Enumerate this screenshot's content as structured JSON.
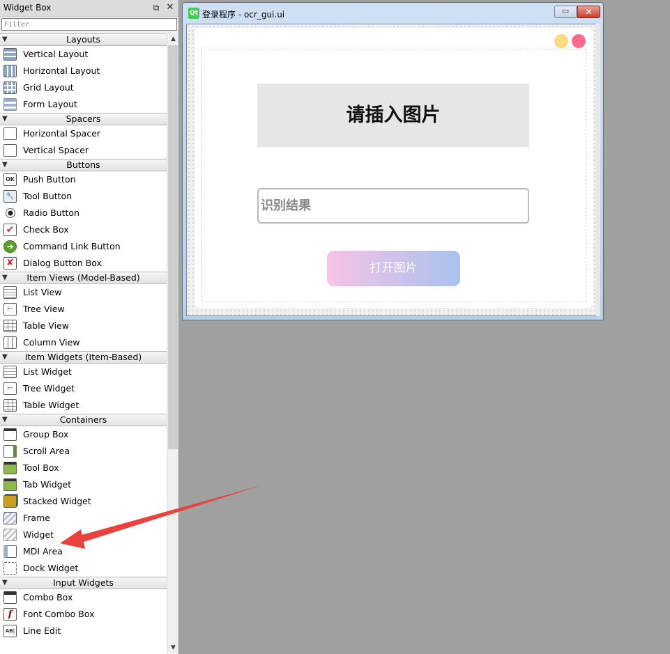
{
  "widget_box": {
    "title": "Widget Box",
    "float_icon": "⧉",
    "close_icon": "✕",
    "filter_placeholder": "Filter",
    "categories": [
      {
        "name": "Layouts",
        "items": [
          {
            "label": "Vertical Layout",
            "icon": "vertical-layout-icon"
          },
          {
            "label": "Horizontal Layout",
            "icon": "horizontal-layout-icon"
          },
          {
            "label": "Grid Layout",
            "icon": "grid-layout-icon"
          },
          {
            "label": "Form Layout",
            "icon": "form-layout-icon"
          }
        ]
      },
      {
        "name": "Spacers",
        "items": [
          {
            "label": "Horizontal Spacer",
            "icon": "horizontal-spacer-icon"
          },
          {
            "label": "Vertical Spacer",
            "icon": "vertical-spacer-icon"
          }
        ]
      },
      {
        "name": "Buttons",
        "items": [
          {
            "label": "Push Button",
            "icon": "push-button-icon",
            "glyph": "OK"
          },
          {
            "label": "Tool Button",
            "icon": "tool-button-icon",
            "glyph": "🔧"
          },
          {
            "label": "Radio Button",
            "icon": "radio-button-icon"
          },
          {
            "label": "Check Box",
            "icon": "check-box-icon",
            "glyph": "✔"
          },
          {
            "label": "Command Link Button",
            "icon": "command-link-icon",
            "glyph": "➜"
          },
          {
            "label": "Dialog Button Box",
            "icon": "dialog-button-box-icon",
            "glyph": "✘"
          }
        ]
      },
      {
        "name": "Item Views (Model-Based)",
        "items": [
          {
            "label": "List View",
            "icon": "list-view-icon"
          },
          {
            "label": "Tree View",
            "icon": "tree-view-icon",
            "glyph": "⊢"
          },
          {
            "label": "Table View",
            "icon": "table-view-icon"
          },
          {
            "label": "Column View",
            "icon": "column-view-icon"
          }
        ]
      },
      {
        "name": "Item Widgets (Item-Based)",
        "items": [
          {
            "label": "List Widget",
            "icon": "list-widget-icon"
          },
          {
            "label": "Tree Widget",
            "icon": "tree-widget-icon",
            "glyph": "⊢"
          },
          {
            "label": "Table Widget",
            "icon": "table-widget-icon"
          }
        ]
      },
      {
        "name": "Containers",
        "items": [
          {
            "label": "Group Box",
            "icon": "group-box-icon"
          },
          {
            "label": "Scroll Area",
            "icon": "scroll-area-icon"
          },
          {
            "label": "Tool Box",
            "icon": "tool-box-icon"
          },
          {
            "label": "Tab Widget",
            "icon": "tab-widget-icon"
          },
          {
            "label": "Stacked Widget",
            "icon": "stacked-widget-icon"
          },
          {
            "label": "Frame",
            "icon": "frame-icon"
          },
          {
            "label": "Widget",
            "icon": "widget-icon"
          },
          {
            "label": "MDI Area",
            "icon": "mdi-area-icon"
          },
          {
            "label": "Dock Widget",
            "icon": "dock-widget-icon"
          }
        ]
      },
      {
        "name": "Input Widgets",
        "items": [
          {
            "label": "Combo Box",
            "icon": "combo-box-icon"
          },
          {
            "label": "Font Combo Box",
            "icon": "font-combo-box-icon",
            "glyph": "f"
          },
          {
            "label": "Line Edit",
            "icon": "line-edit-icon",
            "glyph": "AB|"
          }
        ]
      }
    ]
  },
  "form_window": {
    "app_icon": "Qt",
    "title": "登录程序 - ocr_gui.ui",
    "minimize_icon": "▭",
    "close_icon": "✕",
    "image_placeholder": "请插入图片",
    "result_placeholder": "识别结果",
    "open_button_label": "打开图片"
  },
  "colors": {
    "dot_yellow": "#ffda80",
    "dot_pink": "#ff6b8e",
    "button_gradient_start": "#f6c3e6",
    "button_gradient_end": "#a9c2ee",
    "arrow": "#e8413e"
  }
}
